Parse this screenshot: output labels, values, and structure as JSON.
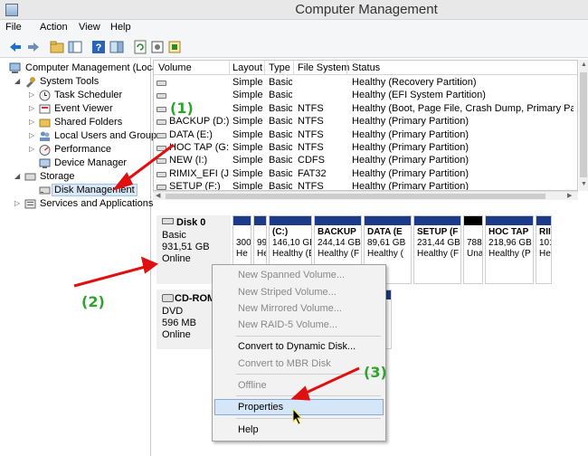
{
  "window": {
    "title": "Computer Management"
  },
  "menu": [
    "File",
    "Action",
    "View",
    "Help"
  ],
  "toolbar_icons": [
    "back-arrow-icon",
    "forward-arrow-icon",
    "up-folder-icon",
    "show-hide-tree-icon",
    "help-icon",
    "properties-pane-icon",
    "refresh-icon",
    "settings-icon",
    "export-icon"
  ],
  "tree": {
    "root": "Computer Management (Local",
    "system_tools": "System Tools",
    "task_scheduler": "Task Scheduler",
    "event_viewer": "Event Viewer",
    "shared_folders": "Shared Folders",
    "local_users": "Local Users and Groups",
    "performance": "Performance",
    "device_manager": "Device Manager",
    "storage": "Storage",
    "disk_management": "Disk Management",
    "services": "Services and Applications"
  },
  "volumes": {
    "columns": [
      "Volume",
      "Layout",
      "Type",
      "File System",
      "Status"
    ],
    "rows": [
      [
        "",
        "Simple",
        "Basic",
        "",
        "Healthy (Recovery Partition)"
      ],
      [
        "",
        "Simple",
        "Basic",
        "",
        "Healthy (EFI System Partition)"
      ],
      [
        "",
        "Simple",
        "Basic",
        "NTFS",
        "Healthy (Boot, Page File, Crash Dump, Primary Partitio"
      ],
      [
        "BACKUP (D:)",
        "Simple",
        "Basic",
        "NTFS",
        "Healthy (Primary Partition)"
      ],
      [
        "DATA (E:)",
        "Simple",
        "Basic",
        "NTFS",
        "Healthy (Primary Partition)"
      ],
      [
        "HOC TAP (G:)",
        "Simple",
        "Basic",
        "NTFS",
        "Healthy (Primary Partition)"
      ],
      [
        "NEW (I:)",
        "Simple",
        "Basic",
        "CDFS",
        "Healthy (Primary Partition)"
      ],
      [
        "RIMIX_EFI (J:)",
        "Simple",
        "Basic",
        "FAT32",
        "Healthy (Primary Partition)"
      ],
      [
        "SETUP (F:)",
        "Simple",
        "Basic",
        "NTFS",
        "Healthy (Primary Partition)"
      ]
    ]
  },
  "disk0": {
    "name": "Disk 0",
    "type": "Basic",
    "size": "931,51 GB",
    "status": "Online",
    "partitions": [
      {
        "l1": "",
        "l2": "300",
        "l3": "He"
      },
      {
        "l1": "",
        "l2": "99",
        "l3": "He"
      },
      {
        "l1": "(C:)",
        "l2": "146,10 GB",
        "l3": "Healthy (B"
      },
      {
        "l1": "BACKUP",
        "l2": "244,14 GB",
        "l3": "Healthy (F"
      },
      {
        "l1": "DATA (E",
        "l2": "89,61 GB",
        "l3": "Healthy ("
      },
      {
        "l1": "SETUP (F",
        "l2": "231,44 GB",
        "l3": "Healthy (F"
      },
      {
        "l1": "",
        "l2": "788",
        "l3": "Una"
      },
      {
        "l1": "HOC TAP",
        "l2": "218,96 GB",
        "l3": "Healthy (P"
      },
      {
        "l1": "RII",
        "l2": "101",
        "l3": "He"
      }
    ]
  },
  "cdrom": {
    "name": "CD-ROM",
    "type": "DVD",
    "size": "596 MB",
    "status": "Online"
  },
  "context_menu": {
    "new_spanned": "New Spanned Volume...",
    "new_striped": "New Striped Volume...",
    "new_mirrored": "New Mirrored Volume...",
    "new_raid5": "New RAID-5 Volume...",
    "convert_dynamic": "Convert to Dynamic Disk...",
    "convert_mbr": "Convert to MBR Disk",
    "offline": "Offline",
    "properties": "Properties",
    "help": "Help"
  },
  "annotations": {
    "a1": "(1)",
    "a2": "(2)",
    "a3": "(3)"
  },
  "colors": {
    "arrow": "#e01010",
    "annotation": "#2ea32e",
    "partition_bar": "#1b3a87",
    "unallocated_bar": "#000000"
  }
}
